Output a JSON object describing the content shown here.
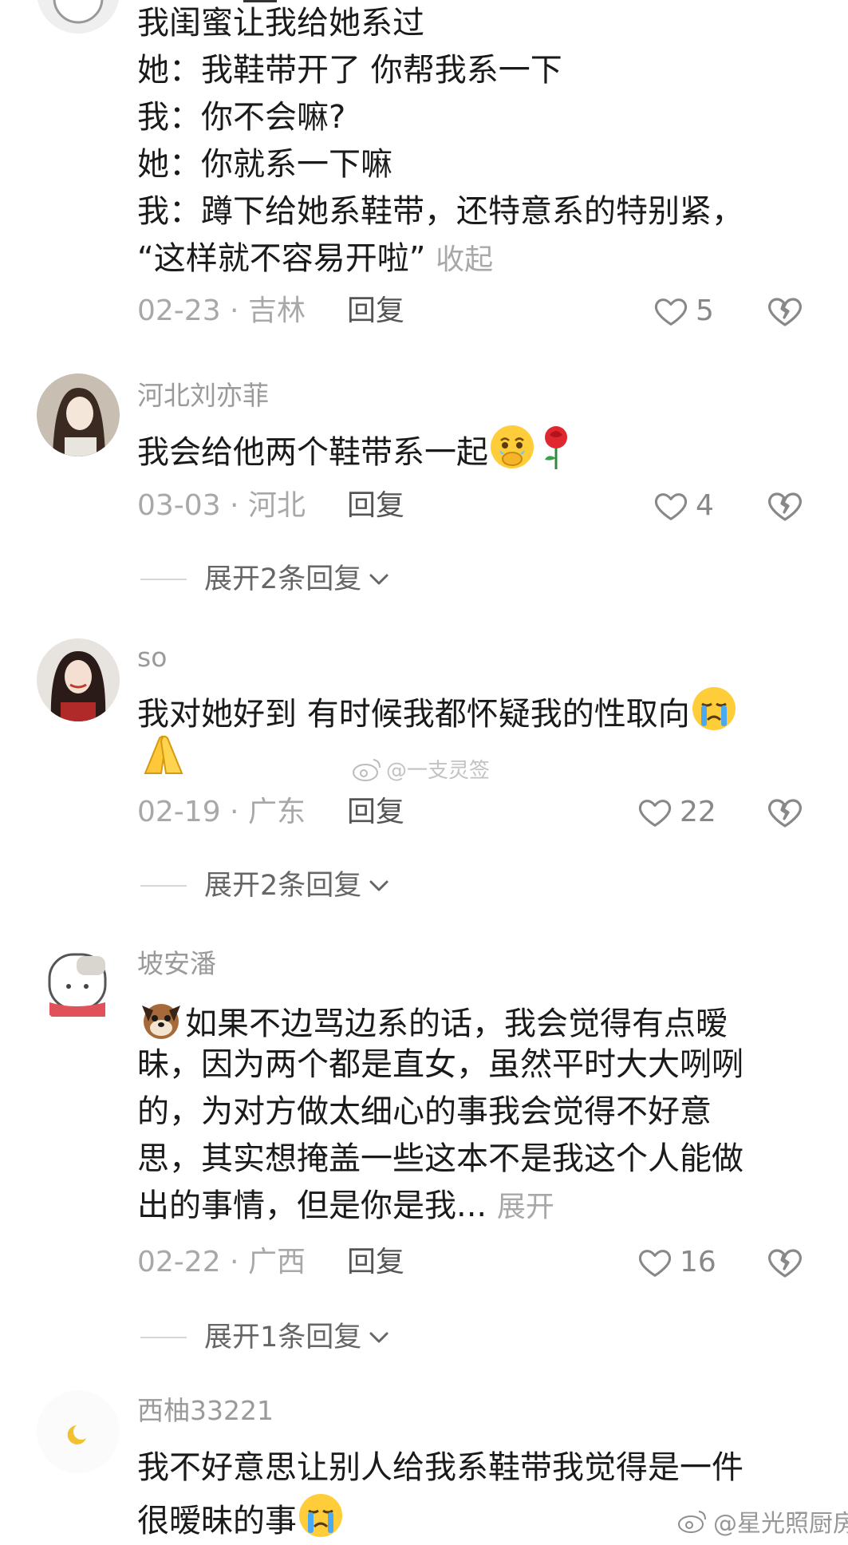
{
  "comments": [
    {
      "username": "",
      "lines": [
        "我闺蜜让我给她系过",
        "她：我鞋带开了 你帮我系一下",
        "我：你不会嘛?",
        "她：你就系一下嘛",
        "我：蹲下给她系鞋带，还特意系的特别紧，",
        "“这样就不容易开啦”"
      ],
      "toggle": "收起",
      "date": "02-23",
      "location": "吉林",
      "reply_label": "回复",
      "likes": "5",
      "avatar_icon": "cartoon-avatar"
    },
    {
      "username": "河北刘亦菲",
      "lines": [
        "我会给他两个鞋带系一起"
      ],
      "emojis": [
        "covering-mouth-tear-emoji",
        "rose-emoji"
      ],
      "date": "03-03",
      "location": "河北",
      "reply_label": "回复",
      "likes": "4",
      "expand": "展开2条回复",
      "avatar_icon": "photo-avatar"
    },
    {
      "username": "so",
      "lines": [
        "我对她好到 有时候我都怀疑我的性取向"
      ],
      "emojis": [
        "crying-emoji",
        "praying-hands-emoji"
      ],
      "date": "02-19",
      "location": "广东",
      "reply_label": "回复",
      "likes": "22",
      "expand": "展开2条回复",
      "avatar_icon": "photo-avatar"
    },
    {
      "username": "坡安潘",
      "lines": [
        "如果不边骂边系的话，我会觉得有点暧",
        "昧，因为两个都是直女，虽然平时大大咧咧",
        "的，为对方做太细心的事我会觉得不好意",
        "思，其实想掩盖一些这本不是我这个人能做",
        "出的事情，但是你是我..."
      ],
      "toggle": "展开",
      "emojis": [
        "dog-emoji"
      ],
      "date": "02-22",
      "location": "广西",
      "reply_label": "回复",
      "likes": "16",
      "expand": "展开1条回复",
      "avatar_icon": "cartoon-avatar"
    },
    {
      "username": "西柚33221",
      "lines": [
        "我不好意思让别人给我系鞋带我觉得是一件",
        "很暧昧的事"
      ],
      "emojis": [
        "crying-emoji"
      ],
      "avatar_icon": "moon-avatar"
    }
  ],
  "watermarks": {
    "center": "@一支灵签",
    "bottom": "@星光照厨房"
  },
  "colors": {
    "text": "#1a1a1a",
    "meta": "#a8a8a8",
    "username": "#9a9a9a"
  }
}
